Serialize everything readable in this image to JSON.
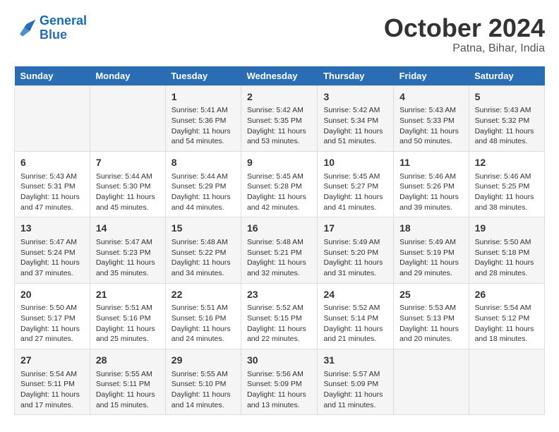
{
  "header": {
    "logo_line1": "General",
    "logo_line2": "Blue",
    "month": "October 2024",
    "location": "Patna, Bihar, India"
  },
  "weekdays": [
    "Sunday",
    "Monday",
    "Tuesday",
    "Wednesday",
    "Thursday",
    "Friday",
    "Saturday"
  ],
  "weeks": [
    [
      {
        "day": "",
        "info": ""
      },
      {
        "day": "",
        "info": ""
      },
      {
        "day": "1",
        "info": "Sunrise: 5:41 AM\nSunset: 5:36 PM\nDaylight: 11 hours and 54 minutes."
      },
      {
        "day": "2",
        "info": "Sunrise: 5:42 AM\nSunset: 5:35 PM\nDaylight: 11 hours and 53 minutes."
      },
      {
        "day": "3",
        "info": "Sunrise: 5:42 AM\nSunset: 5:34 PM\nDaylight: 11 hours and 51 minutes."
      },
      {
        "day": "4",
        "info": "Sunrise: 5:43 AM\nSunset: 5:33 PM\nDaylight: 11 hours and 50 minutes."
      },
      {
        "day": "5",
        "info": "Sunrise: 5:43 AM\nSunset: 5:32 PM\nDaylight: 11 hours and 48 minutes."
      }
    ],
    [
      {
        "day": "6",
        "info": "Sunrise: 5:43 AM\nSunset: 5:31 PM\nDaylight: 11 hours and 47 minutes."
      },
      {
        "day": "7",
        "info": "Sunrise: 5:44 AM\nSunset: 5:30 PM\nDaylight: 11 hours and 45 minutes."
      },
      {
        "day": "8",
        "info": "Sunrise: 5:44 AM\nSunset: 5:29 PM\nDaylight: 11 hours and 44 minutes."
      },
      {
        "day": "9",
        "info": "Sunrise: 5:45 AM\nSunset: 5:28 PM\nDaylight: 11 hours and 42 minutes."
      },
      {
        "day": "10",
        "info": "Sunrise: 5:45 AM\nSunset: 5:27 PM\nDaylight: 11 hours and 41 minutes."
      },
      {
        "day": "11",
        "info": "Sunrise: 5:46 AM\nSunset: 5:26 PM\nDaylight: 11 hours and 39 minutes."
      },
      {
        "day": "12",
        "info": "Sunrise: 5:46 AM\nSunset: 5:25 PM\nDaylight: 11 hours and 38 minutes."
      }
    ],
    [
      {
        "day": "13",
        "info": "Sunrise: 5:47 AM\nSunset: 5:24 PM\nDaylight: 11 hours and 37 minutes."
      },
      {
        "day": "14",
        "info": "Sunrise: 5:47 AM\nSunset: 5:23 PM\nDaylight: 11 hours and 35 minutes."
      },
      {
        "day": "15",
        "info": "Sunrise: 5:48 AM\nSunset: 5:22 PM\nDaylight: 11 hours and 34 minutes."
      },
      {
        "day": "16",
        "info": "Sunrise: 5:48 AM\nSunset: 5:21 PM\nDaylight: 11 hours and 32 minutes."
      },
      {
        "day": "17",
        "info": "Sunrise: 5:49 AM\nSunset: 5:20 PM\nDaylight: 11 hours and 31 minutes."
      },
      {
        "day": "18",
        "info": "Sunrise: 5:49 AM\nSunset: 5:19 PM\nDaylight: 11 hours and 29 minutes."
      },
      {
        "day": "19",
        "info": "Sunrise: 5:50 AM\nSunset: 5:18 PM\nDaylight: 11 hours and 28 minutes."
      }
    ],
    [
      {
        "day": "20",
        "info": "Sunrise: 5:50 AM\nSunset: 5:17 PM\nDaylight: 11 hours and 27 minutes."
      },
      {
        "day": "21",
        "info": "Sunrise: 5:51 AM\nSunset: 5:16 PM\nDaylight: 11 hours and 25 minutes."
      },
      {
        "day": "22",
        "info": "Sunrise: 5:51 AM\nSunset: 5:16 PM\nDaylight: 11 hours and 24 minutes."
      },
      {
        "day": "23",
        "info": "Sunrise: 5:52 AM\nSunset: 5:15 PM\nDaylight: 11 hours and 22 minutes."
      },
      {
        "day": "24",
        "info": "Sunrise: 5:52 AM\nSunset: 5:14 PM\nDaylight: 11 hours and 21 minutes."
      },
      {
        "day": "25",
        "info": "Sunrise: 5:53 AM\nSunset: 5:13 PM\nDaylight: 11 hours and 20 minutes."
      },
      {
        "day": "26",
        "info": "Sunrise: 5:54 AM\nSunset: 5:12 PM\nDaylight: 11 hours and 18 minutes."
      }
    ],
    [
      {
        "day": "27",
        "info": "Sunrise: 5:54 AM\nSunset: 5:11 PM\nDaylight: 11 hours and 17 minutes."
      },
      {
        "day": "28",
        "info": "Sunrise: 5:55 AM\nSunset: 5:11 PM\nDaylight: 11 hours and 15 minutes."
      },
      {
        "day": "29",
        "info": "Sunrise: 5:55 AM\nSunset: 5:10 PM\nDaylight: 11 hours and 14 minutes."
      },
      {
        "day": "30",
        "info": "Sunrise: 5:56 AM\nSunset: 5:09 PM\nDaylight: 11 hours and 13 minutes."
      },
      {
        "day": "31",
        "info": "Sunrise: 5:57 AM\nSunset: 5:09 PM\nDaylight: 11 hours and 11 minutes."
      },
      {
        "day": "",
        "info": ""
      },
      {
        "day": "",
        "info": ""
      }
    ]
  ]
}
